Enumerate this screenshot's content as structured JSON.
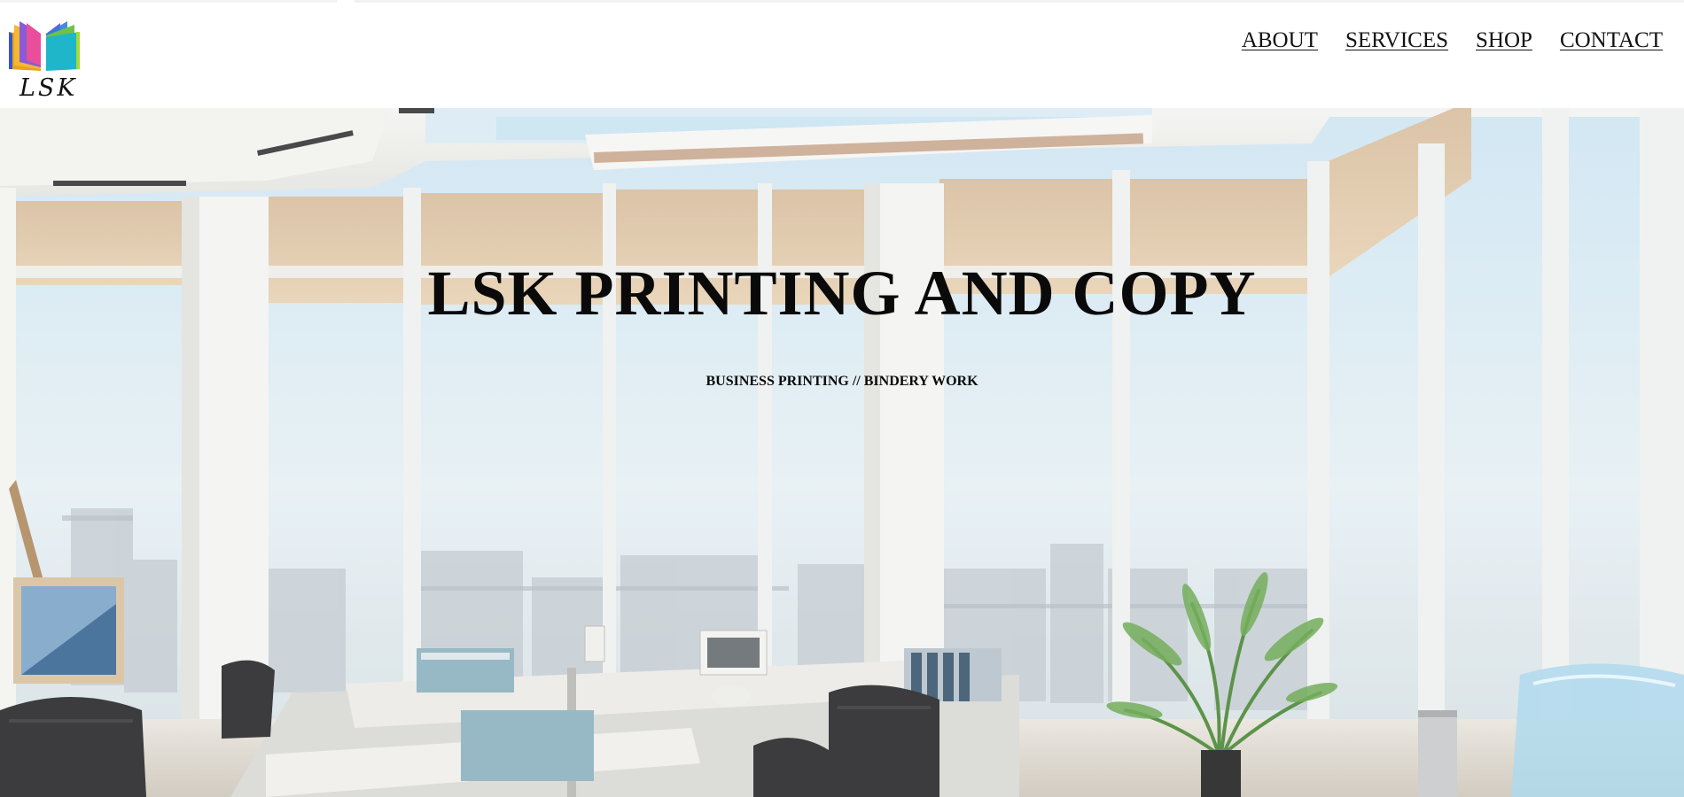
{
  "header": {
    "logo_text": "LSK"
  },
  "nav": {
    "items": [
      {
        "label": "ABOUT"
      },
      {
        "label": "SERVICES"
      },
      {
        "label": "SHOP"
      },
      {
        "label": "CONTACT"
      }
    ]
  },
  "hero": {
    "title": "LSK PRINTING AND COPY",
    "subtitle": "BUSINESS PRINTING // BINDERY WORK"
  },
  "colors": {
    "background": "#ffffff",
    "text": "#0a0a0a",
    "logo_book": [
      "#3a56d6",
      "#e94f9c",
      "#f4a623",
      "#6bc24a",
      "#1fb6c9"
    ]
  }
}
